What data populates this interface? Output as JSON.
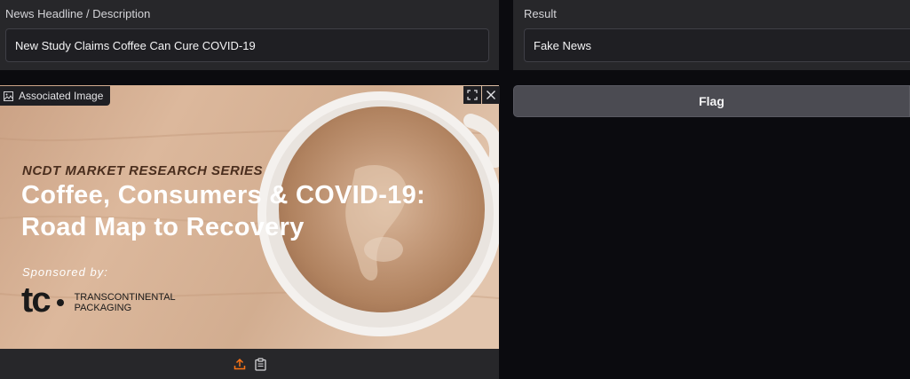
{
  "headline": {
    "label": "News Headline / Description",
    "value": "New Study Claims Coffee Can Cure COVID-19"
  },
  "result": {
    "label": "Result",
    "value": "Fake News"
  },
  "image": {
    "label": "Associated Image",
    "series": "NCDT MARKET RESEARCH SERIES",
    "title_line1": "Coffee, Consumers & COVID-19:",
    "title_line2": "Road Map to Recovery",
    "sponsored": "Sponsored by:",
    "logo_line1": "TRANSCONTINENTAL",
    "logo_line2": "PACKAGING",
    "logo_mark": "tc"
  },
  "actions": {
    "flag_label": "Flag"
  },
  "icons": {
    "image": "image-icon",
    "fullscreen": "fullscreen-icon",
    "close": "close-icon",
    "upload": "upload-icon",
    "clipboard": "clipboard-icon"
  },
  "colors": {
    "accent": "#f97316",
    "panel": "#27272a",
    "background": "#0b0b0f"
  }
}
